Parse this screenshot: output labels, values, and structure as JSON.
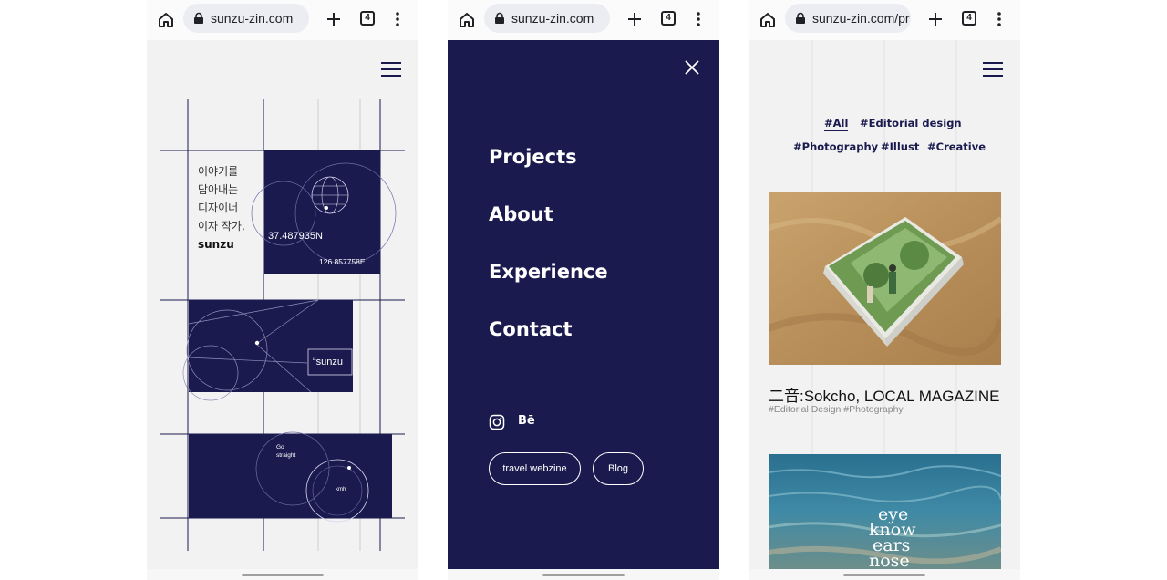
{
  "browser": {
    "screens": [
      {
        "url": "sunzu-zin.com",
        "tab_count": "4"
      },
      {
        "url": "sunzu-zin.com",
        "tab_count": "4"
      },
      {
        "url": "sunzu-zin.com/pr",
        "tab_count": "4"
      }
    ]
  },
  "home": {
    "intro_lines": [
      "이야기를",
      "담아내는",
      "디자이너",
      "이자 작가,"
    ],
    "intro_name": "sunzu",
    "coord_lat": "37.487935N",
    "coord_lng": "126.857758E",
    "quote_label": "“sunzu",
    "go_label_1": "Go",
    "go_label_2": "straight",
    "speed_unit": "kmh"
  },
  "menu": {
    "links": [
      "Projects",
      "About",
      "Experience",
      "Contact"
    ],
    "social_behance": "Bē",
    "buttons": [
      "travel webzine",
      "Blog"
    ]
  },
  "projects": {
    "filters_row1": [
      "#All",
      "#Editorial design"
    ],
    "filters_row2": [
      "#Photography",
      "#Illust",
      "#Creative"
    ],
    "active_filter": "#All",
    "items": [
      {
        "title": "二音:Sokcho, LOCAL MAGAZINE",
        "tags": "#Editorial Design #Photography"
      },
      {
        "cover_text": [
          "eye",
          "know",
          "ears",
          "nose"
        ]
      }
    ]
  },
  "colors": {
    "brand_navy": "#1a1a4e",
    "page_bg": "#f2f2f2"
  },
  "icons": [
    "home-icon",
    "lock-icon",
    "plus-icon",
    "tabs-icon",
    "more-icon",
    "hamburger-icon",
    "close-icon",
    "instagram-icon",
    "behance-icon"
  ]
}
